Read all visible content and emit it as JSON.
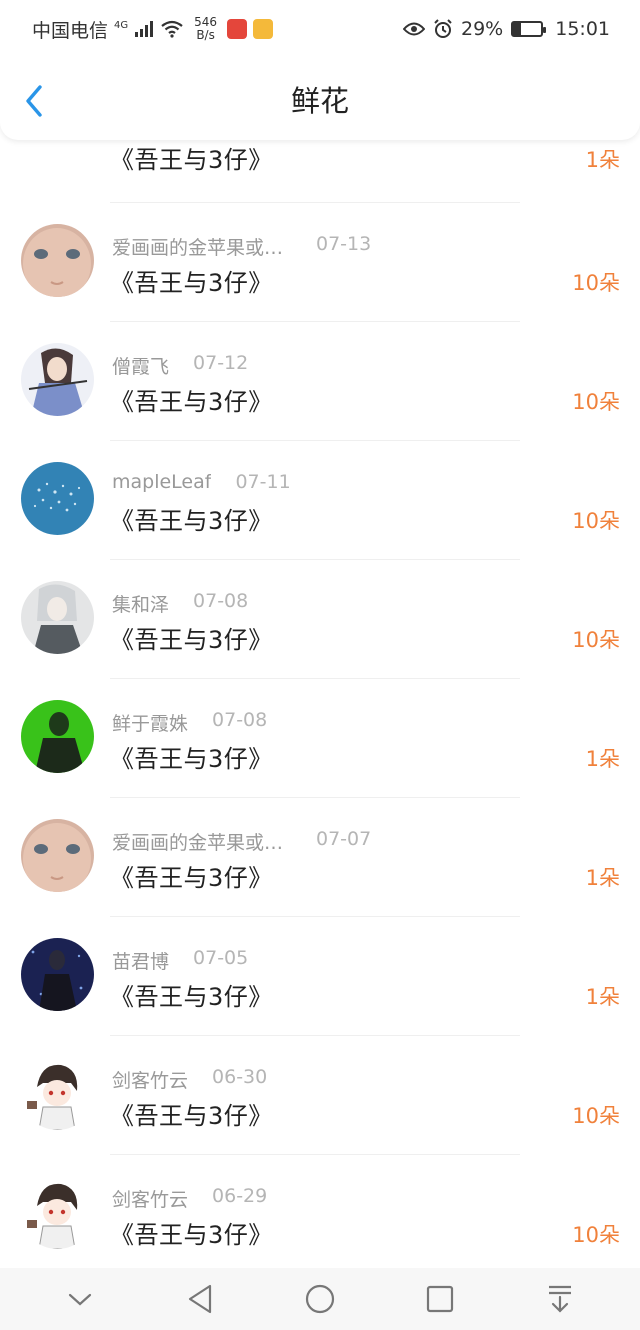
{
  "status_bar": {
    "carrier": "中国电信",
    "network": "4G",
    "speed_value": "546",
    "speed_unit": "B/s",
    "battery": "29%",
    "battery_level": 0.29,
    "time": "15:01"
  },
  "header": {
    "title": "鲜花",
    "back_icon": "chevron-left-icon"
  },
  "colors": {
    "accent": "#2a95e8",
    "count": "#f0813b"
  },
  "items": [
    {
      "user": "",
      "date": "",
      "book": "《吾王与3仔》",
      "count": "1朵"
    },
    {
      "user": "爱画画的金苹果或…",
      "date": "07-13",
      "book": "《吾王与3仔》",
      "count": "10朵"
    },
    {
      "user": "僧霞飞",
      "date": "07-12",
      "book": "《吾王与3仔》",
      "count": "10朵"
    },
    {
      "user": "mapleLeaf",
      "date": "07-11",
      "book": "《吾王与3仔》",
      "count": "10朵"
    },
    {
      "user": "集和泽",
      "date": "07-08",
      "book": "《吾王与3仔》",
      "count": "10朵"
    },
    {
      "user": "鲜于霞姝",
      "date": "07-08",
      "book": "《吾王与3仔》",
      "count": "1朵"
    },
    {
      "user": "爱画画的金苹果或…",
      "date": "07-07",
      "book": "《吾王与3仔》",
      "count": "1朵"
    },
    {
      "user": "苗君博",
      "date": "07-05",
      "book": "《吾王与3仔》",
      "count": "1朵"
    },
    {
      "user": "剑客竹云",
      "date": "06-30",
      "book": "《吾王与3仔》",
      "count": "10朵"
    },
    {
      "user": "剑客竹云",
      "date": "06-29",
      "book": "《吾王与3仔》",
      "count": "10朵"
    }
  ],
  "nav_bar": {
    "icons": [
      "chevron-down-icon",
      "back-triangle-icon",
      "home-circle-icon",
      "recents-square-icon",
      "notification-pull-icon"
    ]
  }
}
